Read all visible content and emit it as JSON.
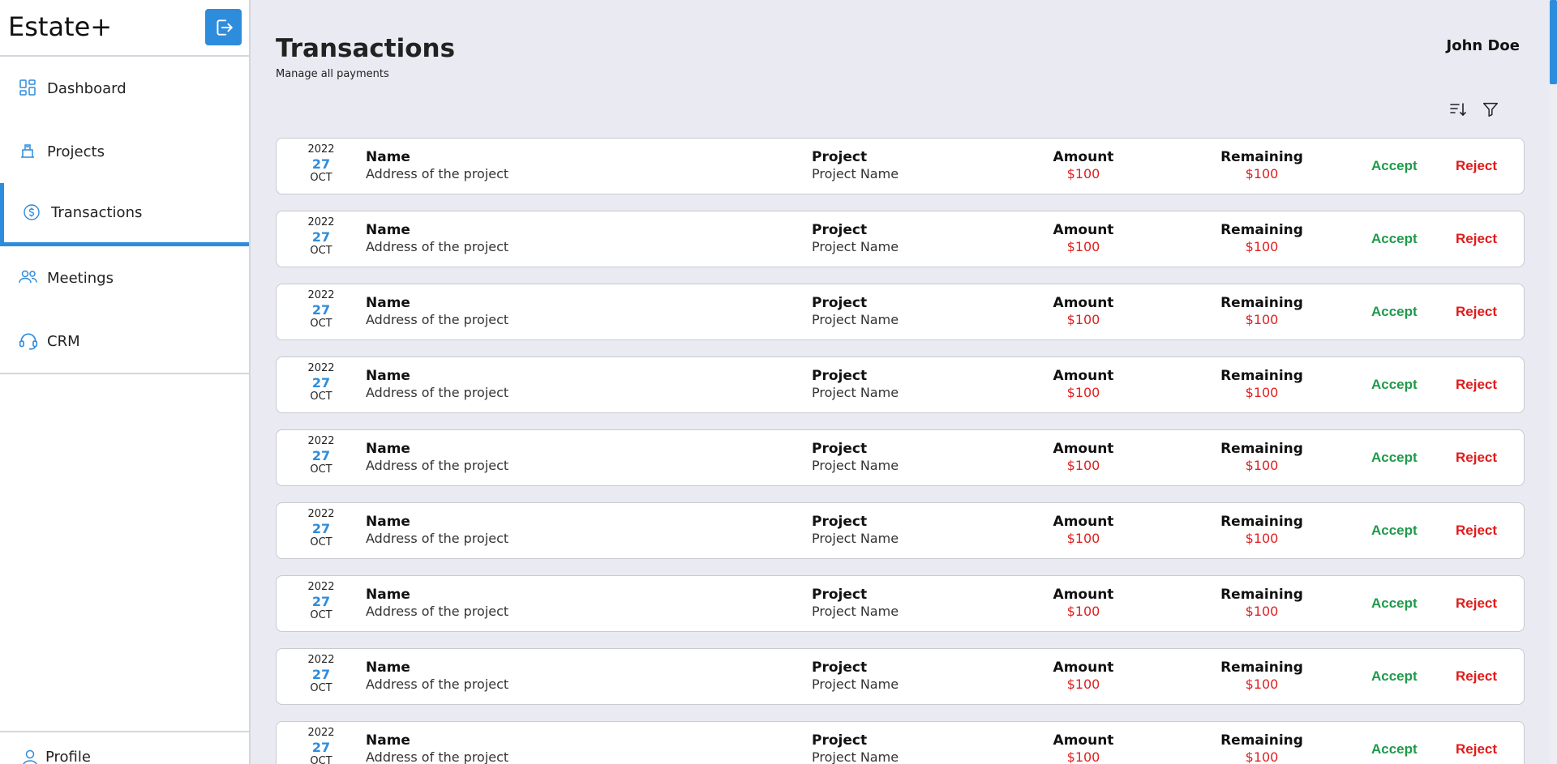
{
  "app": {
    "brand": "Estate+"
  },
  "sidebar": {
    "items": [
      {
        "label": "Dashboard",
        "icon": "dashboard-icon",
        "active": false
      },
      {
        "label": "Projects",
        "icon": "projects-icon",
        "active": false
      },
      {
        "label": "Transactions",
        "icon": "dollar-circle-icon",
        "active": true
      },
      {
        "label": "Meetings",
        "icon": "users-icon",
        "active": false
      },
      {
        "label": "CRM",
        "icon": "headset-icon",
        "active": false
      }
    ],
    "profile_label": "Profile"
  },
  "header": {
    "title": "Transactions",
    "subtitle": "Manage all payments",
    "user_name": "John Doe"
  },
  "colors": {
    "accent": "#2e8cdc",
    "accept": "#1e9a4a",
    "reject": "#e01b1b",
    "money": "#e02020"
  },
  "transactions": [
    {
      "year": "2022",
      "day": "27",
      "month": "OCT",
      "name": "Name",
      "address": "Address of the project",
      "project_head": "Project",
      "project": "Project Name",
      "amount_head": "Amount",
      "amount": "$100",
      "remaining_head": "Remaining",
      "remaining": "$100",
      "accept": "Accept",
      "reject": "Reject"
    },
    {
      "year": "2022",
      "day": "27",
      "month": "OCT",
      "name": "Name",
      "address": "Address of the project",
      "project_head": "Project",
      "project": "Project Name",
      "amount_head": "Amount",
      "amount": "$100",
      "remaining_head": "Remaining",
      "remaining": "$100",
      "accept": "Accept",
      "reject": "Reject"
    },
    {
      "year": "2022",
      "day": "27",
      "month": "OCT",
      "name": "Name",
      "address": "Address of the project",
      "project_head": "Project",
      "project": "Project Name",
      "amount_head": "Amount",
      "amount": "$100",
      "remaining_head": "Remaining",
      "remaining": "$100",
      "accept": "Accept",
      "reject": "Reject"
    },
    {
      "year": "2022",
      "day": "27",
      "month": "OCT",
      "name": "Name",
      "address": "Address of the project",
      "project_head": "Project",
      "project": "Project Name",
      "amount_head": "Amount",
      "amount": "$100",
      "remaining_head": "Remaining",
      "remaining": "$100",
      "accept": "Accept",
      "reject": "Reject"
    },
    {
      "year": "2022",
      "day": "27",
      "month": "OCT",
      "name": "Name",
      "address": "Address of the project",
      "project_head": "Project",
      "project": "Project Name",
      "amount_head": "Amount",
      "amount": "$100",
      "remaining_head": "Remaining",
      "remaining": "$100",
      "accept": "Accept",
      "reject": "Reject"
    },
    {
      "year": "2022",
      "day": "27",
      "month": "OCT",
      "name": "Name",
      "address": "Address of the project",
      "project_head": "Project",
      "project": "Project Name",
      "amount_head": "Amount",
      "amount": "$100",
      "remaining_head": "Remaining",
      "remaining": "$100",
      "accept": "Accept",
      "reject": "Reject"
    },
    {
      "year": "2022",
      "day": "27",
      "month": "OCT",
      "name": "Name",
      "address": "Address of the project",
      "project_head": "Project",
      "project": "Project Name",
      "amount_head": "Amount",
      "amount": "$100",
      "remaining_head": "Remaining",
      "remaining": "$100",
      "accept": "Accept",
      "reject": "Reject"
    },
    {
      "year": "2022",
      "day": "27",
      "month": "OCT",
      "name": "Name",
      "address": "Address of the project",
      "project_head": "Project",
      "project": "Project Name",
      "amount_head": "Amount",
      "amount": "$100",
      "remaining_head": "Remaining",
      "remaining": "$100",
      "accept": "Accept",
      "reject": "Reject"
    },
    {
      "year": "2022",
      "day": "27",
      "month": "OCT",
      "name": "Name",
      "address": "Address of the project",
      "project_head": "Project",
      "project": "Project Name",
      "amount_head": "Amount",
      "amount": "$100",
      "remaining_head": "Remaining",
      "remaining": "$100",
      "accept": "Accept",
      "reject": "Reject"
    }
  ]
}
